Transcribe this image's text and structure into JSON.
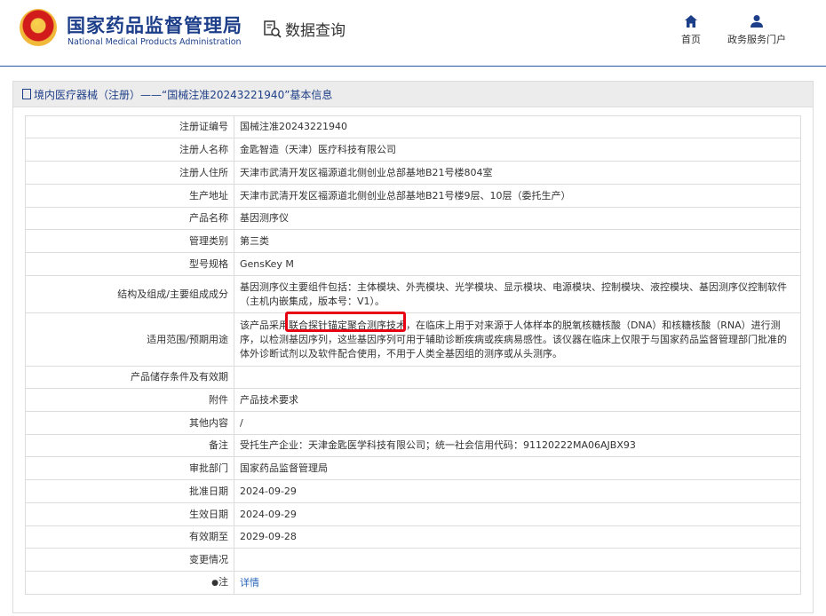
{
  "header": {
    "site_title_cn": "国家药品监督管理局",
    "site_title_en": "National Medical Products Administration",
    "data_query": "数据查询",
    "nav": {
      "home": "首页",
      "portal": "政务服务门户"
    }
  },
  "panel": {
    "title": "境内医疗器械（注册）——“国械注准20243221940”基本信息"
  },
  "rows": [
    {
      "label": "注册证编号",
      "value": "国械注准20243221940"
    },
    {
      "label": "注册人名称",
      "value": "金匙智造（天津）医疗科技有限公司"
    },
    {
      "label": "注册人住所",
      "value": "天津市武清开发区福源道北侧创业总部基地B21号楼804室"
    },
    {
      "label": "生产地址",
      "value": "天津市武清开发区福源道北侧创业总部基地B21号楼9层、10层（委托生产）"
    },
    {
      "label": "产品名称",
      "value": "基因测序仪"
    },
    {
      "label": "管理类别",
      "value": "第三类"
    },
    {
      "label": "型号规格",
      "value": "GensKey M"
    },
    {
      "label": "结构及组成/主要组成成分",
      "value": "基因测序仪主要组件包括：主体模块、外壳模块、光学模块、显示模块、电源模块、控制模块、液控模块、基因测序仪控制软件（主机内嵌集成，版本号：V1）。"
    },
    {
      "label": "适用范围/预期用途",
      "value": "该产品采用联合探针锚定聚合测序技术，在临床上用于对来源于人体样本的脱氧核糖核酸（DNA）和核糖核酸（RNA）进行测序，以检测基因序列，这些基因序列可用于辅助诊断疾病或疾病易感性。该仪器在临床上仅限于与国家药品监督管理部门批准的体外诊断试剂以及软件配合使用，不用于人类全基因组的测序或从头测序。"
    },
    {
      "label": "产品储存条件及有效期",
      "value": ""
    },
    {
      "label": "附件",
      "value": "产品技术要求"
    },
    {
      "label": "其他内容",
      "value": "/"
    },
    {
      "label": "备注",
      "value": "受托生产企业：天津金匙医学科技有限公司；统一社会信用代码：91120222MA06AJBX93"
    },
    {
      "label": "审批部门",
      "value": "国家药品监督管理局"
    },
    {
      "label": "批准日期",
      "value": "2024-09-29"
    },
    {
      "label": "生效日期",
      "value": "2024-09-29"
    },
    {
      "label": "有效期至",
      "value": "2029-09-28"
    },
    {
      "label": "变更情况",
      "value": ""
    },
    {
      "label": "注",
      "value": "详情"
    }
  ]
}
